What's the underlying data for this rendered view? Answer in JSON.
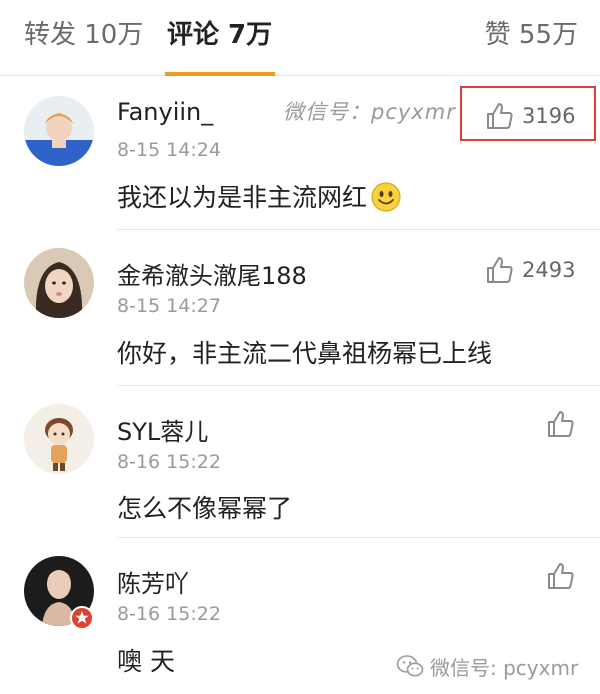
{
  "tabs": {
    "repost": "转发 10万",
    "comments": "评论 7万",
    "likes": "赞 55万"
  },
  "watermark_top": "微信号：pcyxmr",
  "watermark_bottom": "微信号: pcyxmr",
  "comments": [
    {
      "username": "Fanyiin_",
      "time": "8-15 14:24",
      "text": "我还以为是非主流网红",
      "emoji": "smiley-face-icon",
      "likes": "3196"
    },
    {
      "username": "金希澈头澈尾188",
      "time": "8-15 14:27",
      "text": "你好，非主流二代鼻祖杨幂已上线",
      "likes": "2493"
    },
    {
      "username": "SYL蓉儿",
      "time": "8-16 15:22",
      "text": "怎么不像幂幂了",
      "likes": ""
    },
    {
      "username": "陈芳吖",
      "time": "8-16 15:22",
      "text": "噢 天",
      "likes": "",
      "badge": "verified-badge-icon"
    }
  ],
  "colors": {
    "accent": "#f09a1c",
    "highlight": "#e23b3b",
    "badge": "#e0402f"
  }
}
